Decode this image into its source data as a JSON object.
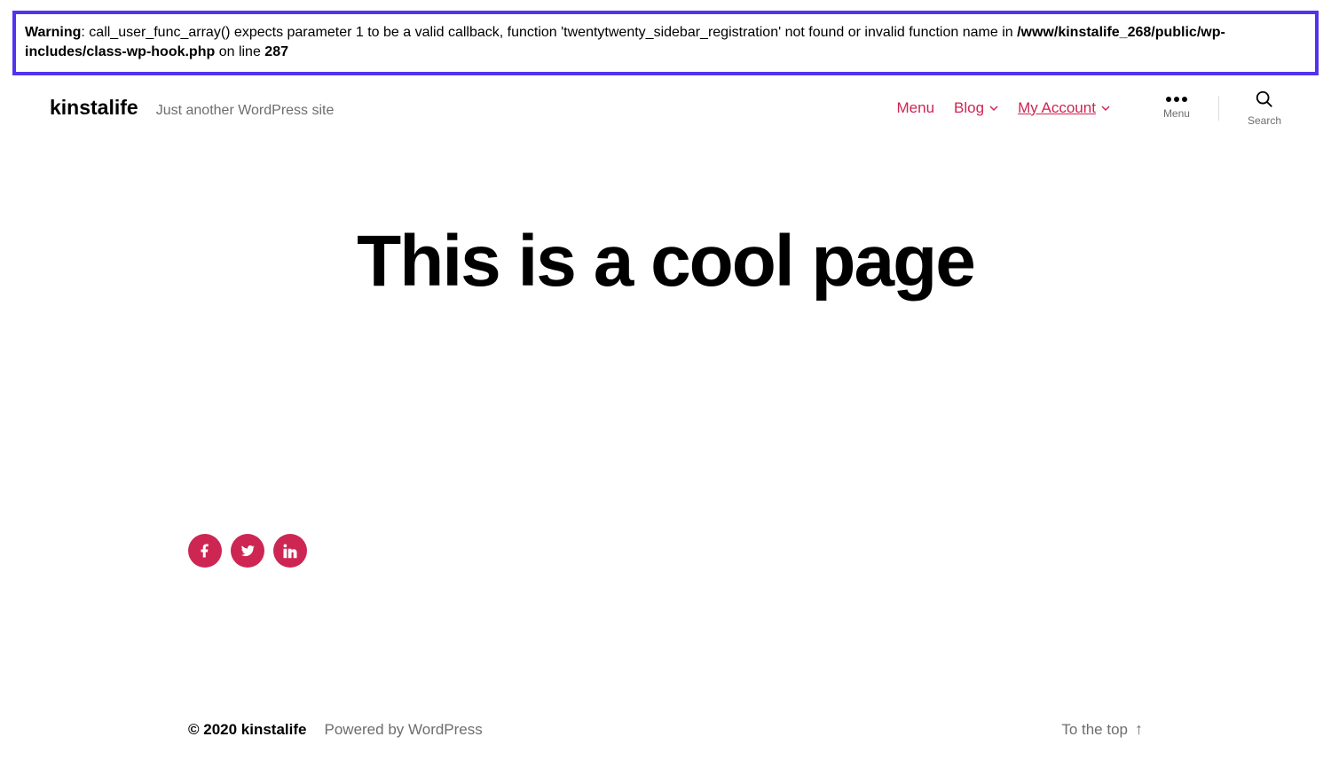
{
  "warning": {
    "label": "Warning",
    "message_part1": ": call_user_func_array() expects parameter 1 to be a valid callback, function 'twentytwenty_sidebar_registration' not found or invalid function name in ",
    "file_path": "/www/kinstalife_268/public/wp-includes/class-wp-hook.php",
    "on_line_text": " on line ",
    "line_number": "287"
  },
  "header": {
    "site_title": "kinstalife",
    "tagline": "Just another WordPress site",
    "nav": {
      "menu": "Menu",
      "blog": "Blog",
      "my_account": "My Account"
    },
    "menu_toggle_label": "Menu",
    "search_toggle_label": "Search"
  },
  "page": {
    "title": "This is a cool page"
  },
  "social": {
    "facebook": "facebook",
    "twitter": "twitter",
    "linkedin": "linkedin"
  },
  "footer": {
    "copyright": "© 2020 kinstalife",
    "powered": "Powered by WordPress",
    "to_top": "To the top"
  }
}
